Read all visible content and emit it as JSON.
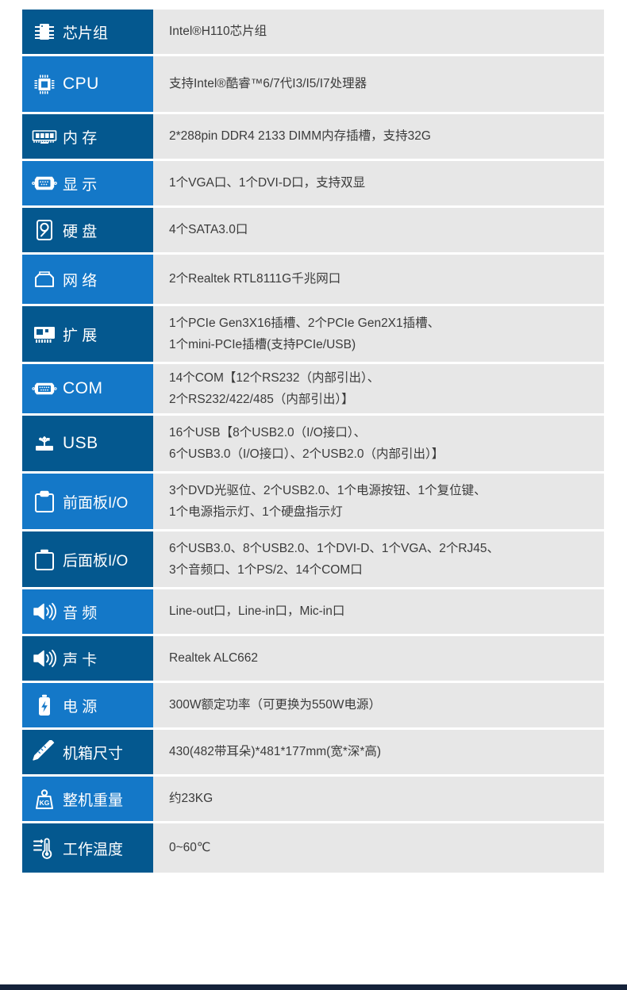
{
  "colors": {
    "blue_dark": "#04588f",
    "blue_light": "#1478c8",
    "value_bg": "#e7e7e7",
    "text": "#3b3b3b",
    "bottom_bar": "#15223a"
  },
  "rows": [
    {
      "icon": "chipset-icon",
      "label": "芯片组",
      "lines": [
        "Intel®H110芯片组"
      ],
      "shade": "dark",
      "height": "h-sm",
      "label_style": "tight"
    },
    {
      "icon": "cpu-icon",
      "label": "CPU",
      "lines": [
        "支持Intel®酷睿™6/7代I3/I5/I7处理器"
      ],
      "shade": "light",
      "height": "h-lg",
      "label_style": "lat"
    },
    {
      "icon": "memory-icon",
      "label": "内 存",
      "lines": [
        "2*288pin DDR4 2133 DIMM内存插槽，支持32G"
      ],
      "shade": "dark",
      "height": "h-sm",
      "label_style": "tight"
    },
    {
      "icon": "display-icon",
      "label": "显 示",
      "lines": [
        "1个VGA口、1个DVI-D口，支持双显"
      ],
      "shade": "light",
      "height": "h-sm",
      "label_style": "tight"
    },
    {
      "icon": "harddisk-icon",
      "label": "硬 盘",
      "lines": [
        " 4个SATA3.0口"
      ],
      "shade": "dark",
      "height": "h-sm",
      "label_style": "tight"
    },
    {
      "icon": "network-icon",
      "label": "网 络",
      "lines": [
        "2个Realtek RTL8111G千兆网口"
      ],
      "shade": "light",
      "height": "h-md",
      "label_style": "tight"
    },
    {
      "icon": "expansion-icon",
      "label": "扩 展",
      "lines": [
        "1个PCIe Gen3X16插槽、2个PCIe Gen2X1插槽、",
        "1个mini-PCIe插槽(支持PCIe/USB)"
      ],
      "shade": "dark",
      "height": "h-lg",
      "label_style": "tight"
    },
    {
      "icon": "com-port-icon",
      "label": "COM",
      "lines": [
        "14个COM【12个RS232（内部引出）、",
        "2个RS232/422/485（内部引出）】"
      ],
      "shade": "light",
      "height": "h-md",
      "label_style": "lat"
    },
    {
      "icon": "usb-icon",
      "label": "USB",
      "lines": [
        "16个USB【8个USB2.0（I/O接口）、",
        "6个USB3.0（I/O接口）、2个USB2.0（内部引出）】"
      ],
      "shade": "dark",
      "height": "h-lg",
      "label_style": "lat"
    },
    {
      "icon": "front-panel-icon",
      "label": "前面板I/O",
      "lines": [
        "3个DVD光驱位、2个USB2.0、1个电源按钮、1个复位键、",
        "1个电源指示灯、1个硬盘指示灯"
      ],
      "shade": "light",
      "height": "h-lg",
      "label_style": "tight"
    },
    {
      "icon": "rear-panel-icon",
      "label": "后面板I/O",
      "lines": [
        "6个USB3.0、8个USB2.0、1个DVI-D、1个VGA、2个RJ45、",
        "3个音频口、1个PS/2、14个COM口"
      ],
      "shade": "dark",
      "height": "h-lg",
      "label_style": "tight"
    },
    {
      "icon": "audio-icon",
      "label": "音 频",
      "lines": [
        "Line-out口，Line-in口，Mic-in口"
      ],
      "shade": "light",
      "height": "h-sm",
      "label_style": "tight"
    },
    {
      "icon": "soundcard-icon",
      "label": "声 卡",
      "lines": [
        "Realtek ALC662"
      ],
      "shade": "dark",
      "height": "h-sm",
      "label_style": "tight"
    },
    {
      "icon": "power-icon",
      "label": "电 源",
      "lines": [
        "300W额定功率（可更换为550W电源）"
      ],
      "shade": "light",
      "height": "h-sm",
      "label_style": "tight"
    },
    {
      "icon": "dimension-icon",
      "label": "机箱尺寸",
      "lines": [
        "430(482带耳朵)*481*177mm(宽*深*高)"
      ],
      "shade": "dark",
      "height": "h-sm",
      "label_style": "tight"
    },
    {
      "icon": "weight-icon",
      "label": "整机重量",
      "lines": [
        "约23KG"
      ],
      "shade": "light",
      "height": "h-sm",
      "label_style": "tight"
    },
    {
      "icon": "temperature-icon",
      "label": "工作温度",
      "lines": [
        "0~60℃"
      ],
      "shade": "dark",
      "height": "h-md",
      "label_style": "tight"
    }
  ]
}
